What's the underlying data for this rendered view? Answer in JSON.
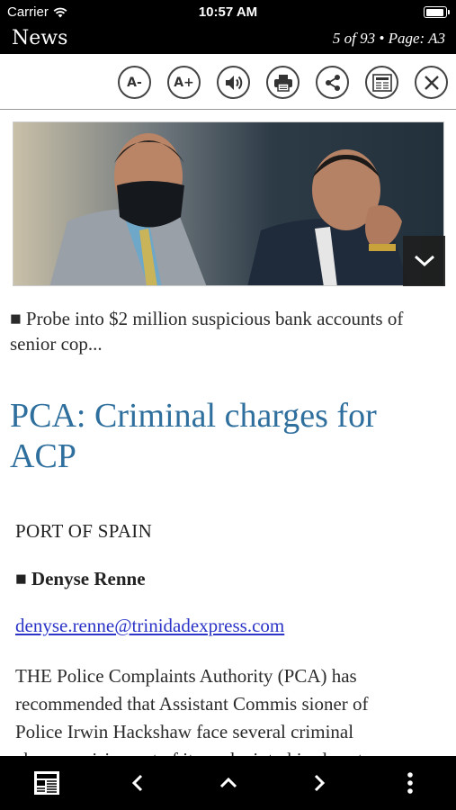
{
  "status_bar": {
    "carrier": "Carrier",
    "time": "10:57 AM"
  },
  "nav": {
    "title": "News",
    "page_info": "5 of 93 • Page: A3"
  },
  "toolbar": {
    "decrease_font_label": "A-",
    "increase_font_label": "A+",
    "icons": [
      "decrease-font-icon",
      "increase-font-icon",
      "speaker-icon",
      "printer-icon",
      "share-icon",
      "newspaper-icon",
      "close-icon"
    ]
  },
  "article": {
    "caption": "■ Probe into $2 million suspicious bank accounts of senior cop...",
    "headline": "PCA: Criminal charges for ACP",
    "dateline": "PORT OF SPAIN",
    "byline": "■ Denyse Renne",
    "email": "denyse.renne@trinidadexpress.com",
    "body_lines": [
      "THE Police Complaints Authority (PCA) has",
      "recommended that Assistant Commis sioner of",
      "Police Irwin Hackshaw face several criminal",
      "charges arising out of its probe into his close to"
    ]
  },
  "bottom_bar": {
    "icons": [
      "page-view-icon",
      "chevron-left-icon",
      "chevron-up-icon",
      "chevron-right-icon",
      "more-vertical-icon"
    ]
  },
  "colors": {
    "headline": "#2e6f9e",
    "link": "#2b34c7",
    "bars": "#000000"
  }
}
